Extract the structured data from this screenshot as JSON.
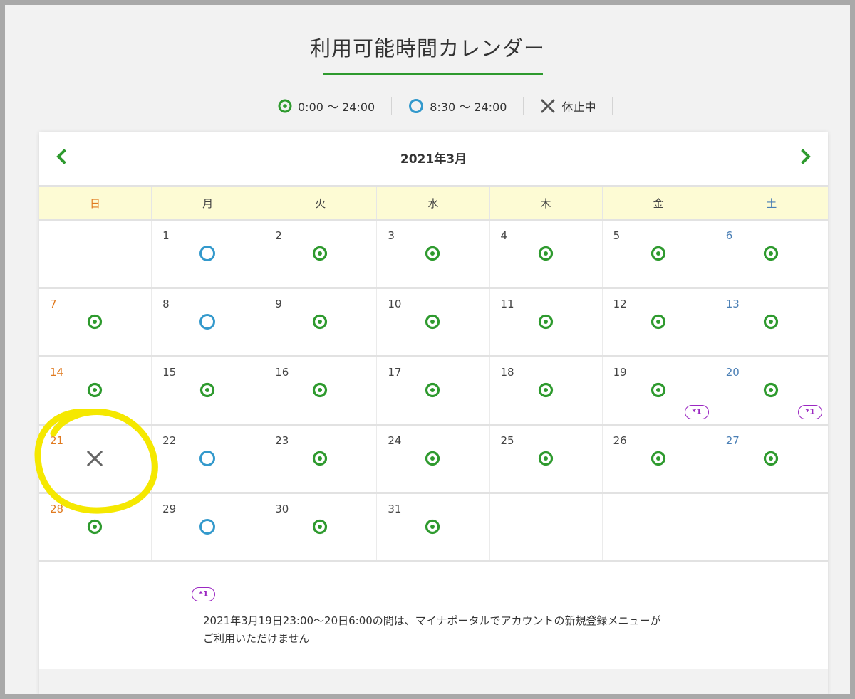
{
  "page": {
    "title": "利用可能時間カレンダー",
    "accent_color": "#2e9a2e"
  },
  "legend": [
    {
      "icon": "double-circle-icon",
      "label": "0:00 ～ 24:00"
    },
    {
      "icon": "circle-icon",
      "label": "8:30 ～ 24:00"
    },
    {
      "icon": "cross-icon",
      "label": "休止中"
    }
  ],
  "calendar": {
    "month_label": "2021年3月",
    "prev_icon": "chevron-left-icon",
    "next_icon": "chevron-right-icon",
    "weekdays": [
      "日",
      "月",
      "火",
      "水",
      "木",
      "金",
      "土"
    ],
    "weeks": [
      [
        {
          "day": "",
          "status": ""
        },
        {
          "day": "1",
          "status": "circle"
        },
        {
          "day": "2",
          "status": "double-circle"
        },
        {
          "day": "3",
          "status": "double-circle"
        },
        {
          "day": "4",
          "status": "double-circle"
        },
        {
          "day": "5",
          "status": "double-circle"
        },
        {
          "day": "6",
          "status": "double-circle"
        }
      ],
      [
        {
          "day": "7",
          "status": "double-circle"
        },
        {
          "day": "8",
          "status": "circle"
        },
        {
          "day": "9",
          "status": "double-circle"
        },
        {
          "day": "10",
          "status": "double-circle"
        },
        {
          "day": "11",
          "status": "double-circle"
        },
        {
          "day": "12",
          "status": "double-circle"
        },
        {
          "day": "13",
          "status": "double-circle"
        }
      ],
      [
        {
          "day": "14",
          "status": "double-circle"
        },
        {
          "day": "15",
          "status": "double-circle"
        },
        {
          "day": "16",
          "status": "double-circle"
        },
        {
          "day": "17",
          "status": "double-circle"
        },
        {
          "day": "18",
          "status": "double-circle"
        },
        {
          "day": "19",
          "status": "double-circle",
          "note": "*1"
        },
        {
          "day": "20",
          "status": "double-circle",
          "note": "*1"
        }
      ],
      [
        {
          "day": "21",
          "status": "cross"
        },
        {
          "day": "22",
          "status": "circle"
        },
        {
          "day": "23",
          "status": "double-circle"
        },
        {
          "day": "24",
          "status": "double-circle"
        },
        {
          "day": "25",
          "status": "double-circle"
        },
        {
          "day": "26",
          "status": "double-circle"
        },
        {
          "day": "27",
          "status": "double-circle"
        }
      ],
      [
        {
          "day": "28",
          "status": "double-circle"
        },
        {
          "day": "29",
          "status": "circle"
        },
        {
          "day": "30",
          "status": "double-circle"
        },
        {
          "day": "31",
          "status": "double-circle"
        },
        {
          "day": "",
          "status": ""
        },
        {
          "day": "",
          "status": ""
        },
        {
          "day": "",
          "status": ""
        }
      ]
    ]
  },
  "notes": {
    "badge": "*1",
    "line1": "2021年3月19日23:00～20日6:00の間は、マイナポータルでアカウントの新規登録メニューが",
    "line2": "ご利用いただけません"
  },
  "colors": {
    "green": "#2e9a2e",
    "blue": "#3399cc",
    "gray_cross": "#666666",
    "sunday": "#e07a1f",
    "saturday": "#4a7fb5",
    "note_purple": "#9b27c2",
    "header_bg": "#fdfbd4",
    "highlight": "#f5e800"
  }
}
